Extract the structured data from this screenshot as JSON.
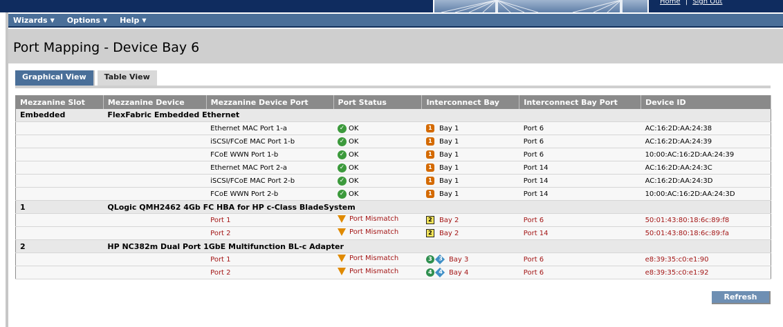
{
  "banner": {
    "home_label": "Home",
    "sep": "|",
    "signout_label": "Sign Out"
  },
  "menu": {
    "items": [
      {
        "label": "Wizards",
        "caret": "▼"
      },
      {
        "label": "Options",
        "caret": "▼"
      },
      {
        "label": "Help",
        "caret": "▼"
      }
    ]
  },
  "page": {
    "title": "Port Mapping - Device Bay 6"
  },
  "tabs": [
    {
      "label": "Graphical View",
      "active": true
    },
    {
      "label": "Table View",
      "active": false
    }
  ],
  "table": {
    "headers": [
      "Mezzanine Slot",
      "Mezzanine Device",
      "Mezzanine Device Port",
      "Port Status",
      "Interconnect Bay",
      "Interconnect Bay Port",
      "Device ID"
    ],
    "groups": [
      {
        "slot": "Embedded",
        "device": "FlexFabric Embedded Ethernet",
        "rows": [
          {
            "port": "Ethernet MAC Port 1-a",
            "status": "OK",
            "bay": "Bay 1",
            "bay_icon": "1",
            "bay_port": "Port 6",
            "device_id": "AC:16:2D:AA:24:38"
          },
          {
            "port": "iSCSI/FCoE MAC Port 1-b",
            "status": "OK",
            "bay": "Bay 1",
            "bay_icon": "1",
            "bay_port": "Port 6",
            "device_id": "AC:16:2D:AA:24:39"
          },
          {
            "port": "FCoE WWN Port 1-b",
            "status": "OK",
            "bay": "Bay 1",
            "bay_icon": "1",
            "bay_port": "Port 6",
            "device_id": "10:00:AC:16:2D:AA:24:39"
          },
          {
            "port": "Ethernet MAC Port 2-a",
            "status": "OK",
            "bay": "Bay 1",
            "bay_icon": "1",
            "bay_port": "Port 14",
            "device_id": "AC:16:2D:AA:24:3C"
          },
          {
            "port": "iSCSI/FCoE MAC Port 2-b",
            "status": "OK",
            "bay": "Bay 1",
            "bay_icon": "1",
            "bay_port": "Port 14",
            "device_id": "AC:16:2D:AA:24:3D"
          },
          {
            "port": "FCoE WWN Port 2-b",
            "status": "OK",
            "bay": "Bay 1",
            "bay_icon": "1",
            "bay_port": "Port 14",
            "device_id": "10:00:AC:16:2D:AA:24:3D"
          }
        ]
      },
      {
        "slot": "1",
        "device": "QLogic QMH2462 4Gb FC HBA for HP c-Class BladeSystem",
        "rows": [
          {
            "port": "Port 1",
            "status": "Port Mismatch",
            "bay": "Bay 2",
            "bay_icon": "2",
            "bay_port": "Port 6",
            "device_id": "50:01:43:80:18:6c:89:f8"
          },
          {
            "port": "Port 2",
            "status": "Port Mismatch",
            "bay": "Bay 2",
            "bay_icon": "2",
            "bay_port": "Port 14",
            "device_id": "50:01:43:80:18:6c:89:fa"
          }
        ]
      },
      {
        "slot": "2",
        "device": "HP NC382m Dual Port 1GbE Multifunction BL-c Adapter",
        "rows": [
          {
            "port": "Port 1",
            "status": "Port Mismatch",
            "bay": "Bay 3",
            "bay_icon": "3",
            "bay_port": "Port 6",
            "device_id": "e8:39:35:c0:e1:90"
          },
          {
            "port": "Port 2",
            "status": "Port Mismatch",
            "bay": "Bay 4",
            "bay_icon": "4",
            "bay_port": "Port 6",
            "device_id": "e8:39:35:c0:e1:92"
          }
        ]
      }
    ]
  },
  "refresh_label": "Refresh",
  "colors": {
    "banner": "#0f2c5f",
    "menubar": "#4a6f99",
    "error_text": "#a31515",
    "ok_green": "#3c9a3c",
    "warn_orange": "#e08a00"
  }
}
